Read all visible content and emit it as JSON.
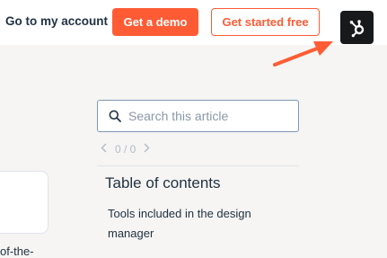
{
  "header": {
    "account_link": "Go to my account",
    "demo_button": "Get a demo",
    "free_button": "Get started free",
    "logo_icon": "hubspot-sprocket-icon"
  },
  "colors": {
    "accent": "#ff5c35",
    "text": "#213343",
    "background": "#f6f5f3",
    "logo_tile": "#17191a",
    "arrow": "#ff5c35"
  },
  "search": {
    "placeholder": "Search this article",
    "value": "",
    "icon": "search-icon"
  },
  "pager": {
    "text": "0 / 0",
    "prev_icon": "chevron-left-icon",
    "next_icon": "chevron-right-icon"
  },
  "toc": {
    "title": "Table of contents",
    "items": [
      "Tools included in the design manager"
    ]
  },
  "left_fragment": {
    "text": "of-the-"
  }
}
